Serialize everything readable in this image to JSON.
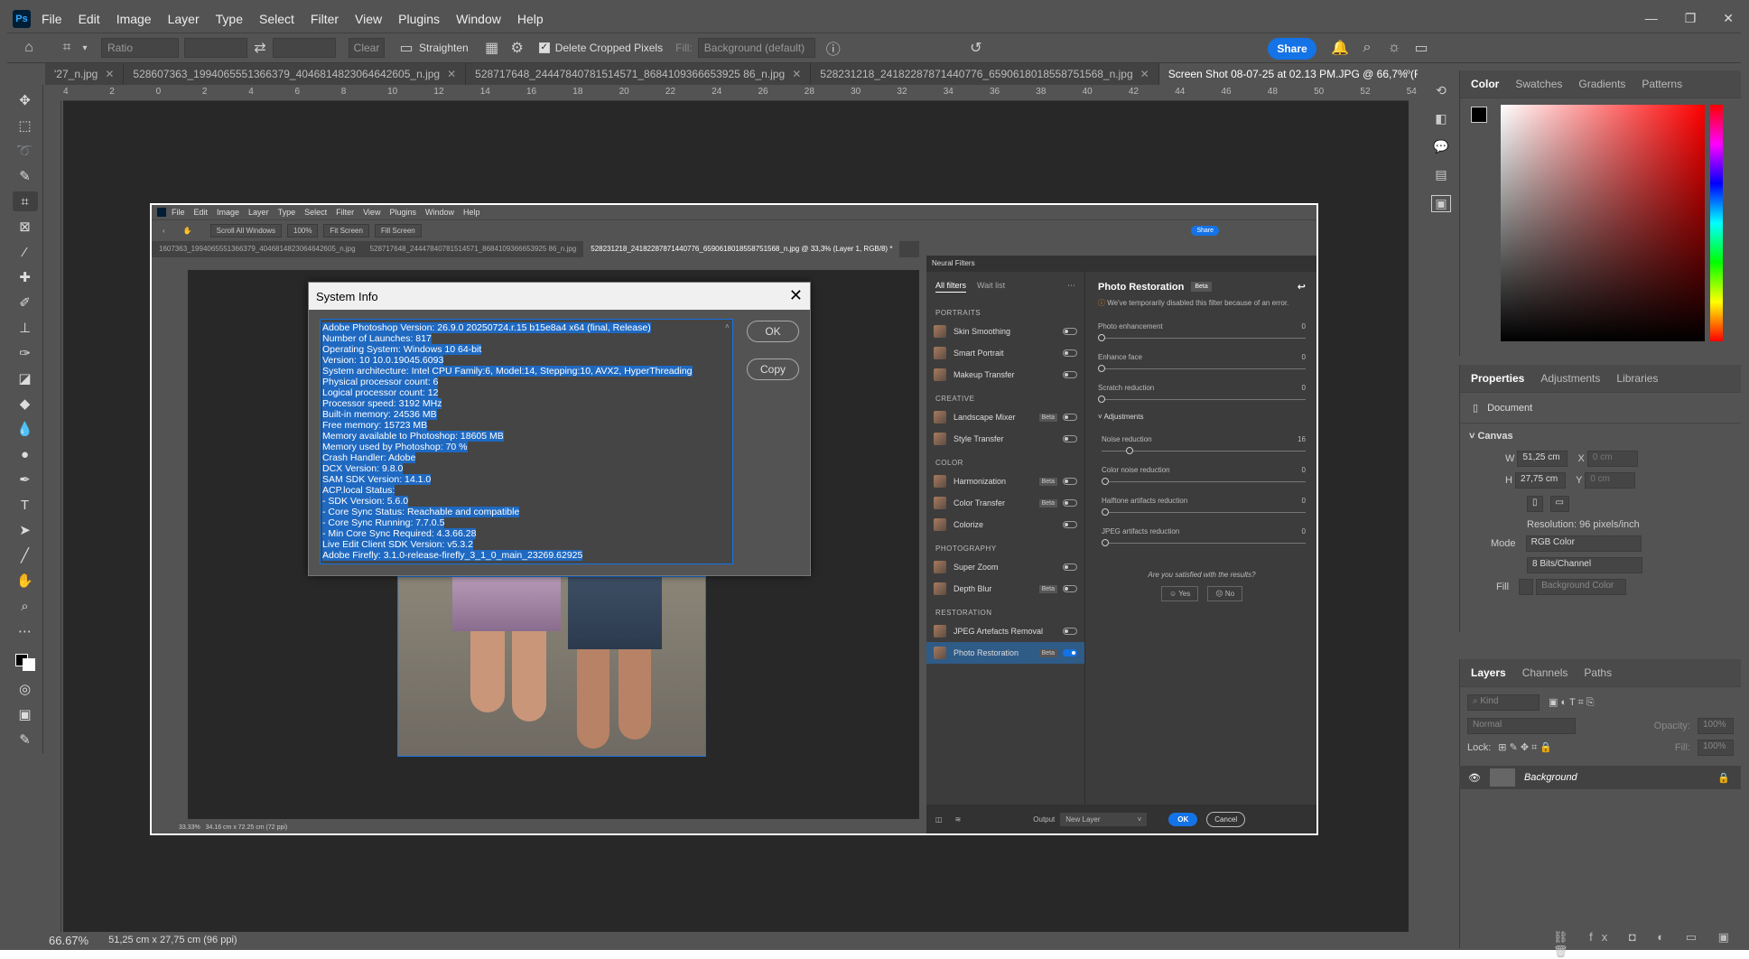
{
  "app": {
    "menu": [
      "File",
      "Edit",
      "Image",
      "Layer",
      "Type",
      "Select",
      "Filter",
      "View",
      "Plugins",
      "Window",
      "Help"
    ],
    "logo": "Ps"
  },
  "options": {
    "ratio": "Ratio",
    "clear": "Clear",
    "straighten": "Straighten",
    "delete_cropped": "Delete Cropped Pixels",
    "fill_label": "Fill:",
    "fill_value": "Background (default)",
    "share": "Share"
  },
  "tabs": [
    {
      "label": "'27_n.jpg"
    },
    {
      "label": "528607363_1994065551366379_4046814823064642605_n.jpg"
    },
    {
      "label": "528717648_24447840781514571_8684109366653925 86_n.jpg"
    },
    {
      "label": "528231218_24182287871440776_6590618018558751568_n.jpg"
    },
    {
      "label": "Screen Shot 08-07-25 at 02.13 PM.JPG @ 66,7% (RGB/8#) *"
    }
  ],
  "ruler": [
    "4",
    "2",
    "0",
    "2",
    "4",
    "6",
    "8",
    "10",
    "12",
    "14",
    "16",
    "18",
    "20",
    "22",
    "24",
    "26",
    "28",
    "30",
    "32",
    "34",
    "36",
    "38",
    "40",
    "42",
    "44",
    "46",
    "48",
    "50",
    "52",
    "54"
  ],
  "status": {
    "zoom": "66.67%",
    "info": "51,25 cm x 27,75 cm (96 ppi)"
  },
  "inner": {
    "menu": [
      "File",
      "Edit",
      "Image",
      "Layer",
      "Type",
      "Select",
      "Filter",
      "View",
      "Plugins",
      "Window",
      "Help"
    ],
    "scroll_all": "Scroll All Windows",
    "zoom_btns": [
      "100%",
      "Fit Screen",
      "Fill Screen"
    ],
    "share": "Share",
    "tabs": [
      "1607363_1994065551366379_4046814823064642605_n.jpg",
      "528717648_24447840781514571_8684109366653925 86_n.jpg",
      "528231218_24182287871440776_6590618018558751568_n.jpg @ 33,3% (Layer 1, RGB/8) *"
    ],
    "status_zoom": "33.33%",
    "status_info": "34.16 cm x 72.25 cm (72 ppi)"
  },
  "neural": {
    "header": "Neural Filters",
    "tab_all": "All filters",
    "tab_wait": "Wait list",
    "sections": [
      {
        "title": "PORTRAITS",
        "items": [
          {
            "label": "Skin Smoothing",
            "beta": "",
            "on": false
          },
          {
            "label": "Smart Portrait",
            "beta": "",
            "on": false
          },
          {
            "label": "Makeup Transfer",
            "beta": "",
            "on": false
          }
        ]
      },
      {
        "title": "CREATIVE",
        "items": [
          {
            "label": "Landscape Mixer",
            "beta": "Beta",
            "on": false
          },
          {
            "label": "Style Transfer",
            "beta": "",
            "on": false
          }
        ]
      },
      {
        "title": "COLOR",
        "items": [
          {
            "label": "Harmonization",
            "beta": "Beta",
            "on": false
          },
          {
            "label": "Color Transfer",
            "beta": "Beta",
            "on": false
          },
          {
            "label": "Colorize",
            "beta": "",
            "on": false
          }
        ]
      },
      {
        "title": "PHOTOGRAPHY",
        "items": [
          {
            "label": "Super Zoom",
            "beta": "",
            "on": false
          },
          {
            "label": "Depth Blur",
            "beta": "Beta",
            "on": false
          }
        ]
      },
      {
        "title": "RESTORATION",
        "items": [
          {
            "label": "JPEG Artefacts Removal",
            "beta": "",
            "on": false
          },
          {
            "label": "Photo Restoration",
            "beta": "Beta",
            "on": true
          }
        ]
      }
    ],
    "detail_title": "Photo Restoration",
    "detail_beta": "Beta",
    "warning": "We've temporarily disabled this filter because of an error.",
    "sliders1": [
      {
        "label": "Photo enhancement",
        "value": "0"
      },
      {
        "label": "Enhance face",
        "value": "0"
      },
      {
        "label": "Scratch reduction",
        "value": "0"
      }
    ],
    "adjust_label": "Adjustments",
    "sliders2": [
      {
        "label": "Noise reduction",
        "value": "16"
      },
      {
        "label": "Color noise reduction",
        "value": "0"
      },
      {
        "label": "Halftone artifacts reduction",
        "value": "0"
      },
      {
        "label": "JPEG artifacts reduction",
        "value": "0"
      }
    ],
    "satisfied": "Are you satisfied with the results?",
    "yes": "Yes",
    "no": "No",
    "output_label": "Output",
    "output_value": "New Layer",
    "ok": "OK",
    "cancel": "Cancel"
  },
  "dialog": {
    "title": "System Info",
    "ok": "OK",
    "copy": "Copy",
    "lines": [
      "Adobe Photoshop Version: 26.9.0 20250724.r.15 b15e8a4  x64 (final, Release)",
      "Number of Launches: 817",
      "Operating System: Windows 10 64-bit",
      "Version: 10 10.0.19045.6093",
      "System architecture: Intel CPU Family:6, Model:14, Stepping:10, AVX2, HyperThreading",
      "Physical processor count: 6",
      "Logical processor count: 12",
      "Processor speed: 3192 MHz",
      "Built-in memory: 24536 MB",
      "Free memory: 15723 MB",
      "Memory available to Photoshop: 18605 MB",
      "Memory used by Photoshop: 70 %",
      "Crash Handler: Adobe",
      "DCX Version: 9.8.0",
      "SAM SDK Version: 14.1.0",
      "ACP.local Status:",
      " - SDK Version: 5.6.0",
      " - Core Sync Status: Reachable and compatible",
      " - Core Sync Running: 7.7.0.5",
      " - Min Core Sync Required: 4.3.66.28",
      "Live Edit Client SDK Version: v5.3.2",
      "Adobe Firefly: 3.1.0-release-firefly_3_1_0_main_23269.62925"
    ]
  },
  "color_panel": {
    "tabs": [
      "Color",
      "Swatches",
      "Gradients",
      "Patterns"
    ]
  },
  "props_panel": {
    "tabs": [
      "Properties",
      "Adjustments",
      "Libraries"
    ],
    "document": "Document",
    "canvas": "Canvas",
    "w_label": "W",
    "w_value": "51,25 cm",
    "x_label": "X",
    "x_value": "0 cm",
    "h_label": "H",
    "h_value": "27,75 cm",
    "y_label": "Y",
    "y_value": "0 cm",
    "resolution": "Resolution: 96 pixels/inch",
    "mode_label": "Mode",
    "mode_value": "RGB Color",
    "bits_value": "8 Bits/Channel",
    "fill_label": "Fill",
    "fill_value": "Background Color"
  },
  "layers_panel": {
    "tabs": [
      "Layers",
      "Channels",
      "Paths"
    ],
    "kind": "Kind",
    "blend": "Normal",
    "opacity_label": "Opacity:",
    "opacity_value": "100%",
    "lock_label": "Lock:",
    "fill_label": "Fill:",
    "fill_value": "100%",
    "layer_name": "Background"
  }
}
